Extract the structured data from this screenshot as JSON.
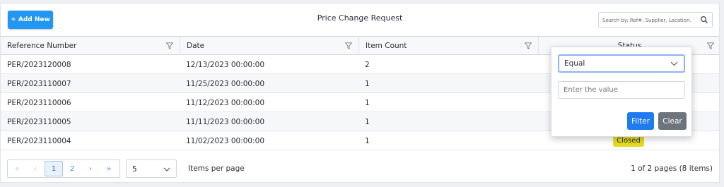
{
  "toolbar": {
    "add_label": "+ Add New",
    "title": "Price Change Request",
    "search_placeholder": "Search by: Ref#, Supplier, Location."
  },
  "table": {
    "columns": [
      "Reference Number",
      "Date",
      "Item Count",
      "Status"
    ],
    "rows": [
      {
        "ref": "PER/2023120008",
        "date": "12/13/2023 00:00:00",
        "count": "2",
        "status": ""
      },
      {
        "ref": "PER/2023110007",
        "date": "11/25/2023 00:00:00",
        "count": "1",
        "status": ""
      },
      {
        "ref": "PER/2023110006",
        "date": "11/12/2023 00:00:00",
        "count": "1",
        "status": ""
      },
      {
        "ref": "PER/2023110005",
        "date": "11/11/2023 00:00:00",
        "count": "1",
        "status": ""
      },
      {
        "ref": "PER/2023110004",
        "date": "11/02/2023 00:00:00",
        "count": "1",
        "status": "Closed"
      }
    ]
  },
  "pager": {
    "first": "«",
    "prev": "‹",
    "pages": [
      "1",
      "2"
    ],
    "current_page": "1",
    "next": "›",
    "last": "»",
    "page_size": "5",
    "page_size_label": "Items per page",
    "info": "1 of 2 pages (8 items)"
  },
  "filter_popup": {
    "operator": "Equal",
    "value_placeholder": "Enter the value",
    "filter_label": "Filter",
    "clear_label": "Clear"
  },
  "colors": {
    "accent": "#2196f3",
    "closed_badge": "#e5dc1e",
    "filter_button": "#1e7bf0",
    "clear_button": "#6c757d"
  }
}
